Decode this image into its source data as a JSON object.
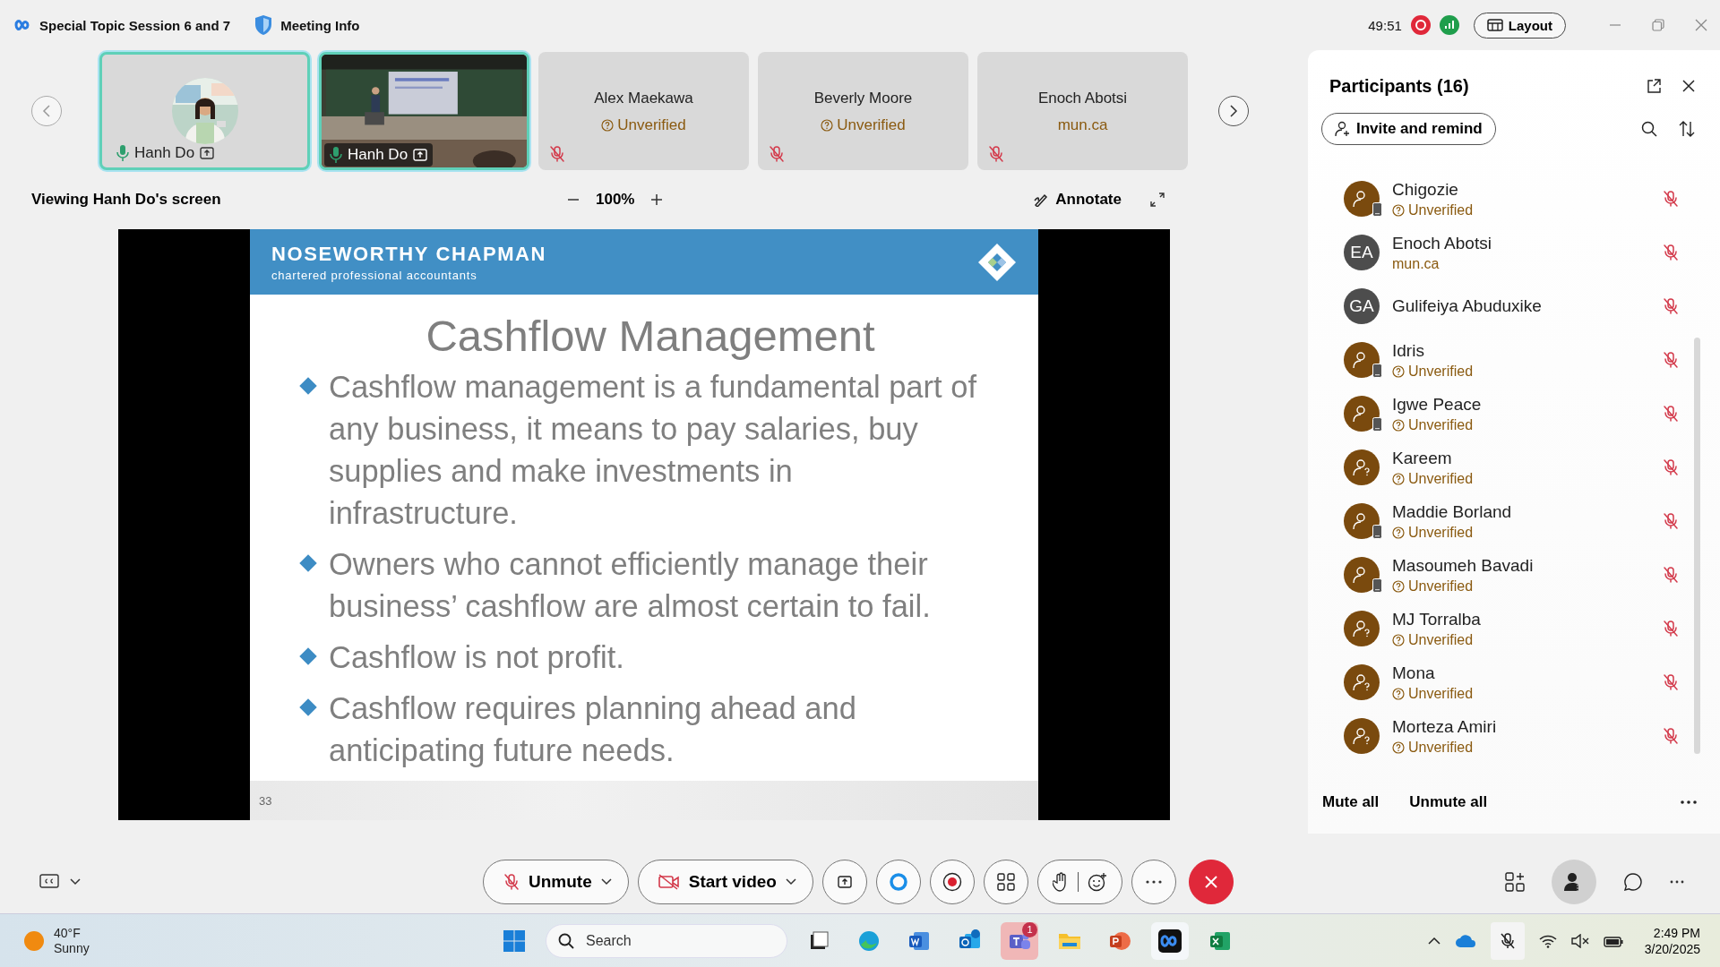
{
  "window": {
    "title": "Special Topic Session 6 and 7",
    "meeting_info": "Meeting Info",
    "timer": "49:51",
    "recording": true,
    "layout_button": "Layout"
  },
  "thumbnails": [
    {
      "name": "Hanh Do",
      "kind": "avatar",
      "muted": false,
      "sharing": true,
      "active": true
    },
    {
      "name": "Hanh Do",
      "kind": "video",
      "muted": false,
      "sharing": true,
      "active": true
    },
    {
      "name": "Alex Maekawa",
      "kind": "empty",
      "status": "Unverified",
      "unverified": true,
      "muted": true,
      "active": false
    },
    {
      "name": "Beverly Moore",
      "kind": "empty",
      "status": "Unverified",
      "unverified": true,
      "muted": true,
      "active": false
    },
    {
      "name": "Enoch Abotsi",
      "kind": "empty",
      "status": "mun.ca",
      "unverified": false,
      "muted": true,
      "active": false
    }
  ],
  "share": {
    "caption": "Viewing Hanh Do's screen",
    "zoom": "100%",
    "annotate": "Annotate",
    "slide": {
      "company": "NOSEWORTHY CHAPMAN",
      "tagline": "chartered professional accountants",
      "title": "Cashflow Management",
      "bullets": [
        "Cashflow management is a fundamental part of any business, it means to pay salaries, buy supplies and make investments in infrastructure.",
        "Owners who cannot efficiently manage their business’ cashflow are almost certain to fail.",
        "Cashflow is not profit.",
        "Cashflow requires planning ahead and anticipating future needs."
      ],
      "page": "33"
    }
  },
  "participants": {
    "title": "Participants (16)",
    "invite": "Invite and remind",
    "people": [
      {
        "name": "Chigozie",
        "kind": "phone",
        "status": "Unverified",
        "unverified": true,
        "muted": true
      },
      {
        "name": "Enoch Abotsi",
        "kind": "initials",
        "initials": "EA",
        "status": "mun.ca",
        "unverified": false,
        "muted": true
      },
      {
        "name": "Gulifeiya Abuduxike",
        "kind": "initials",
        "initials": "GA",
        "muted": true
      },
      {
        "name": "Idris",
        "kind": "phone",
        "status": "Unverified",
        "unverified": true,
        "muted": true
      },
      {
        "name": "Igwe Peace",
        "kind": "phone",
        "status": "Unverified",
        "unverified": true,
        "muted": true
      },
      {
        "name": "Kareem",
        "kind": "guest",
        "status": "Unverified",
        "unverified": true,
        "muted": true
      },
      {
        "name": "Maddie Borland",
        "kind": "phone",
        "status": "Unverified",
        "unverified": true,
        "muted": true
      },
      {
        "name": "Masoumeh Bavadi",
        "kind": "phone",
        "status": "Unverified",
        "unverified": true,
        "muted": true
      },
      {
        "name": "MJ Torralba",
        "kind": "guest",
        "status": "Unverified",
        "unverified": true,
        "muted": true
      },
      {
        "name": "Mona",
        "kind": "guest",
        "status": "Unverified",
        "unverified": true,
        "muted": true
      },
      {
        "name": "Morteza Amiri",
        "kind": "guest",
        "status": "Unverified",
        "unverified": true,
        "muted": true
      }
    ],
    "mute_all": "Mute all",
    "unmute_all": "Unmute all"
  },
  "controls": {
    "unmute": "Unmute",
    "start_video": "Start video"
  },
  "taskbar": {
    "temperature": "40°F",
    "weather": "Sunny",
    "search_placeholder": "Search",
    "teams_badge": "1",
    "time": "2:49 PM",
    "date": "3/20/2025"
  }
}
